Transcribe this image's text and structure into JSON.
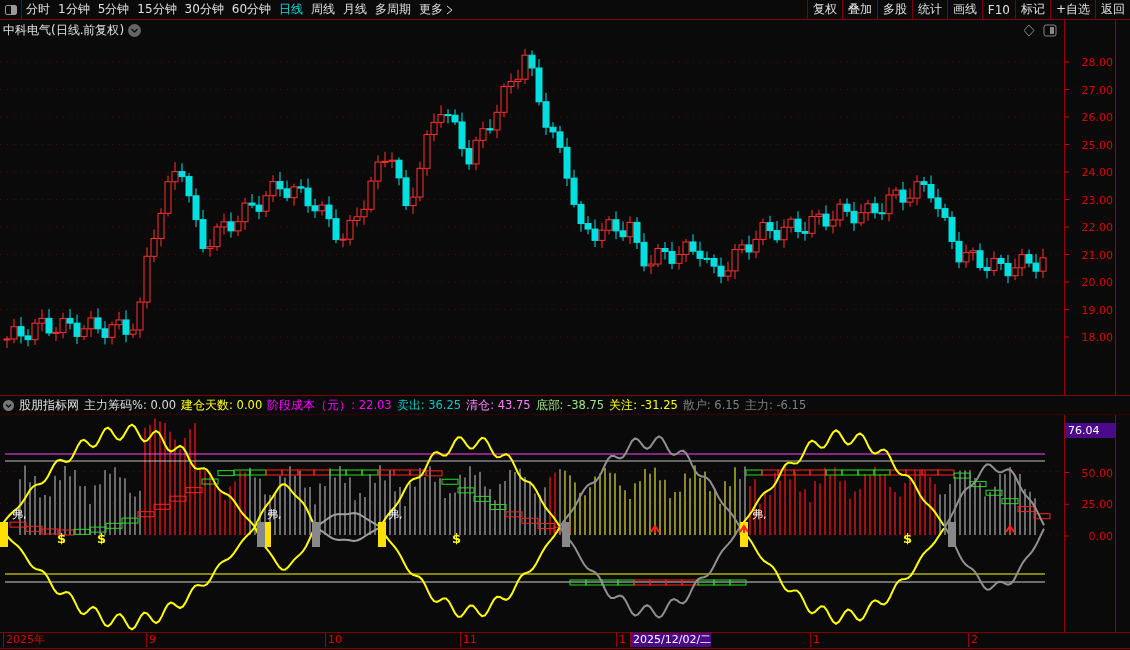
{
  "toolbar": {
    "periods": [
      {
        "label": "分时",
        "selected": false
      },
      {
        "label": "1分钟",
        "selected": false
      },
      {
        "label": "5分钟",
        "selected": false
      },
      {
        "label": "15分钟",
        "selected": false
      },
      {
        "label": "30分钟",
        "selected": false
      },
      {
        "label": "60分钟",
        "selected": false
      },
      {
        "label": "日线",
        "selected": true
      },
      {
        "label": "周线",
        "selected": false
      },
      {
        "label": "月线",
        "selected": false
      },
      {
        "label": "多周期",
        "selected": false
      }
    ],
    "more": "更多",
    "actions": [
      "复权",
      "叠加",
      "多股",
      "统计",
      "画线",
      "F10",
      "标记",
      "+自选",
      "返回"
    ]
  },
  "stock_title": "中科电气(日线.前复权)",
  "price_axis": [
    "28.00",
    "27.00",
    "26.00",
    "25.00",
    "24.00",
    "23.00",
    "22.00",
    "21.00",
    "20.00",
    "19.00",
    "18.00"
  ],
  "indicator": {
    "name": "股朋指标网",
    "values": [
      {
        "text": "主力筹码%: 0.00",
        "kind": "chips"
      },
      {
        "text": "建仓天数: 0.00",
        "kind": "build"
      },
      {
        "text": "阶段成本（元）: 22.03",
        "kind": "cost"
      },
      {
        "text": "卖出: 36.25",
        "kind": "sell"
      },
      {
        "text": "清仓: 43.75",
        "kind": "clear"
      },
      {
        "text": "底部: -38.75",
        "kind": "bottom"
      },
      {
        "text": "关注: -31.25",
        "kind": "watch"
      },
      {
        "text": "散户: 6.15",
        "kind": "retail"
      },
      {
        "text": "主力: -6.15",
        "kind": "main"
      }
    ],
    "signals": [
      {
        "text": "$"
      },
      {
        "text": "$"
      },
      {
        "text": "$"
      },
      {
        "text": "$"
      }
    ],
    "buy_marks": [
      {
        "text": "弗,"
      },
      {
        "text": "弗,"
      },
      {
        "text": "弗,"
      },
      {
        "text": "弗,"
      }
    ]
  },
  "indicator_axis": {
    "badge": "76.04",
    "ticks": [
      "50.00",
      "25.00",
      "0.00"
    ]
  },
  "date_axis": [
    {
      "label": "2025年",
      "highlighted": false
    },
    {
      "label": "9",
      "highlighted": false
    },
    {
      "label": "10",
      "highlighted": false
    },
    {
      "label": "11",
      "highlighted": false
    },
    {
      "label": "1",
      "highlighted": false
    },
    {
      "label": "2025/12/02/二",
      "highlighted": true
    },
    {
      "label": "1",
      "highlighted": false
    },
    {
      "label": "2",
      "highlighted": false
    }
  ]
}
